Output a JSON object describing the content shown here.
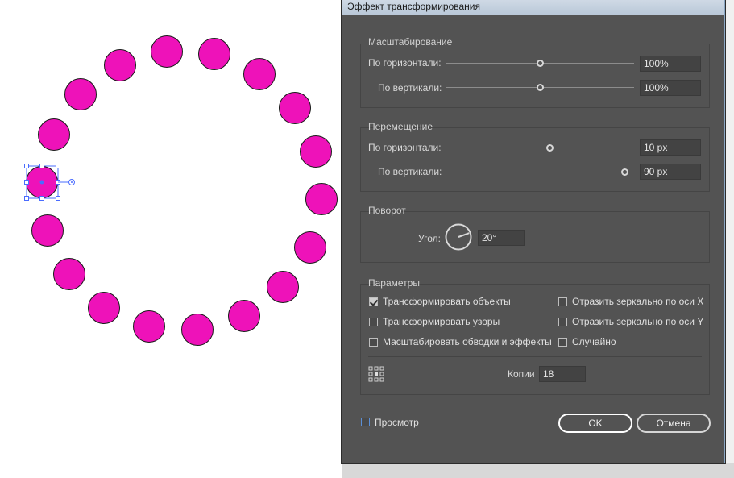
{
  "dialog": {
    "title": "Эффект трансформирования",
    "scale": {
      "title": "Масштабирование",
      "horizontal_label": "По горизонтали:",
      "horizontal_value": "100%",
      "horizontal_level": 0.5,
      "vertical_label": "По вертикали:",
      "vertical_value": "100%",
      "vertical_level": 0.5
    },
    "move": {
      "title": "Перемещение",
      "horizontal_label": "По горизонтали:",
      "horizontal_value": "10 px",
      "horizontal_level": 0.55,
      "vertical_label": "По вертикали:",
      "vertical_value": "90 px",
      "vertical_level": 0.95
    },
    "rotate": {
      "title": "Поворот",
      "angle_label": "Угол:",
      "angle_value": "20°",
      "angle_degrees": 20
    },
    "options": {
      "title": "Параметры",
      "transform_objects": "Трансформировать объекты",
      "transform_objects_checked": true,
      "transform_patterns": "Трансформировать узоры",
      "transform_patterns_checked": false,
      "scale_strokes": "Масштабировать обводки и эффекты",
      "scale_strokes_checked": false,
      "reflect_x": "Отразить зеркально по оси X",
      "reflect_x_checked": false,
      "reflect_y": "Отразить зеркально по оси Y",
      "reflect_y_checked": false,
      "random": "Случайно",
      "random_checked": false,
      "copies_label": "Копии",
      "copies_value": "18",
      "reference_point_icon": "reference-point-grid-icon"
    },
    "preview_label": "Просмотр",
    "preview_checked": false,
    "ok_label": "OK",
    "cancel_label": "Отмена"
  },
  "canvas": {
    "circle_fill": "#ee12b9",
    "circle_stroke": "#1a1a1a",
    "selection_color": "#4a6cff",
    "circle_count": 19
  },
  "colors": {
    "dialog_bg": "#535353",
    "accent": "#4a6cff"
  }
}
